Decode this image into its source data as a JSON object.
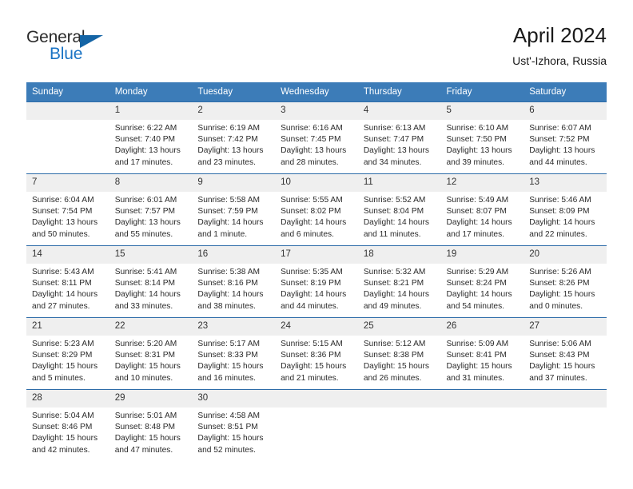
{
  "brand": {
    "word_one": "General",
    "word_two": "Blue",
    "accent_color": "#1a73c4",
    "triangle_color": "#1464a5"
  },
  "header": {
    "title": "April 2024",
    "subtitle": "Ust'-Izhora, Russia"
  },
  "calendar": {
    "header_bg": "#3c7cb8",
    "row_separator_color": "#2d6ca8",
    "daynum_bg": "#efefef",
    "weekday_headers": [
      "Sunday",
      "Monday",
      "Tuesday",
      "Wednesday",
      "Thursday",
      "Friday",
      "Saturday"
    ],
    "weeks": [
      [
        {
          "day": "",
          "sunrise": "",
          "sunset": "",
          "daylight_line1": "",
          "daylight_line2": ""
        },
        {
          "day": "1",
          "sunrise": "Sunrise: 6:22 AM",
          "sunset": "Sunset: 7:40 PM",
          "daylight_line1": "Daylight: 13 hours",
          "daylight_line2": "and 17 minutes."
        },
        {
          "day": "2",
          "sunrise": "Sunrise: 6:19 AM",
          "sunset": "Sunset: 7:42 PM",
          "daylight_line1": "Daylight: 13 hours",
          "daylight_line2": "and 23 minutes."
        },
        {
          "day": "3",
          "sunrise": "Sunrise: 6:16 AM",
          "sunset": "Sunset: 7:45 PM",
          "daylight_line1": "Daylight: 13 hours",
          "daylight_line2": "and 28 minutes."
        },
        {
          "day": "4",
          "sunrise": "Sunrise: 6:13 AM",
          "sunset": "Sunset: 7:47 PM",
          "daylight_line1": "Daylight: 13 hours",
          "daylight_line2": "and 34 minutes."
        },
        {
          "day": "5",
          "sunrise": "Sunrise: 6:10 AM",
          "sunset": "Sunset: 7:50 PM",
          "daylight_line1": "Daylight: 13 hours",
          "daylight_line2": "and 39 minutes."
        },
        {
          "day": "6",
          "sunrise": "Sunrise: 6:07 AM",
          "sunset": "Sunset: 7:52 PM",
          "daylight_line1": "Daylight: 13 hours",
          "daylight_line2": "and 44 minutes."
        }
      ],
      [
        {
          "day": "7",
          "sunrise": "Sunrise: 6:04 AM",
          "sunset": "Sunset: 7:54 PM",
          "daylight_line1": "Daylight: 13 hours",
          "daylight_line2": "and 50 minutes."
        },
        {
          "day": "8",
          "sunrise": "Sunrise: 6:01 AM",
          "sunset": "Sunset: 7:57 PM",
          "daylight_line1": "Daylight: 13 hours",
          "daylight_line2": "and 55 minutes."
        },
        {
          "day": "9",
          "sunrise": "Sunrise: 5:58 AM",
          "sunset": "Sunset: 7:59 PM",
          "daylight_line1": "Daylight: 14 hours",
          "daylight_line2": "and 1 minute."
        },
        {
          "day": "10",
          "sunrise": "Sunrise: 5:55 AM",
          "sunset": "Sunset: 8:02 PM",
          "daylight_line1": "Daylight: 14 hours",
          "daylight_line2": "and 6 minutes."
        },
        {
          "day": "11",
          "sunrise": "Sunrise: 5:52 AM",
          "sunset": "Sunset: 8:04 PM",
          "daylight_line1": "Daylight: 14 hours",
          "daylight_line2": "and 11 minutes."
        },
        {
          "day": "12",
          "sunrise": "Sunrise: 5:49 AM",
          "sunset": "Sunset: 8:07 PM",
          "daylight_line1": "Daylight: 14 hours",
          "daylight_line2": "and 17 minutes."
        },
        {
          "day": "13",
          "sunrise": "Sunrise: 5:46 AM",
          "sunset": "Sunset: 8:09 PM",
          "daylight_line1": "Daylight: 14 hours",
          "daylight_line2": "and 22 minutes."
        }
      ],
      [
        {
          "day": "14",
          "sunrise": "Sunrise: 5:43 AM",
          "sunset": "Sunset: 8:11 PM",
          "daylight_line1": "Daylight: 14 hours",
          "daylight_line2": "and 27 minutes."
        },
        {
          "day": "15",
          "sunrise": "Sunrise: 5:41 AM",
          "sunset": "Sunset: 8:14 PM",
          "daylight_line1": "Daylight: 14 hours",
          "daylight_line2": "and 33 minutes."
        },
        {
          "day": "16",
          "sunrise": "Sunrise: 5:38 AM",
          "sunset": "Sunset: 8:16 PM",
          "daylight_line1": "Daylight: 14 hours",
          "daylight_line2": "and 38 minutes."
        },
        {
          "day": "17",
          "sunrise": "Sunrise: 5:35 AM",
          "sunset": "Sunset: 8:19 PM",
          "daylight_line1": "Daylight: 14 hours",
          "daylight_line2": "and 44 minutes."
        },
        {
          "day": "18",
          "sunrise": "Sunrise: 5:32 AM",
          "sunset": "Sunset: 8:21 PM",
          "daylight_line1": "Daylight: 14 hours",
          "daylight_line2": "and 49 minutes."
        },
        {
          "day": "19",
          "sunrise": "Sunrise: 5:29 AM",
          "sunset": "Sunset: 8:24 PM",
          "daylight_line1": "Daylight: 14 hours",
          "daylight_line2": "and 54 minutes."
        },
        {
          "day": "20",
          "sunrise": "Sunrise: 5:26 AM",
          "sunset": "Sunset: 8:26 PM",
          "daylight_line1": "Daylight: 15 hours",
          "daylight_line2": "and 0 minutes."
        }
      ],
      [
        {
          "day": "21",
          "sunrise": "Sunrise: 5:23 AM",
          "sunset": "Sunset: 8:29 PM",
          "daylight_line1": "Daylight: 15 hours",
          "daylight_line2": "and 5 minutes."
        },
        {
          "day": "22",
          "sunrise": "Sunrise: 5:20 AM",
          "sunset": "Sunset: 8:31 PM",
          "daylight_line1": "Daylight: 15 hours",
          "daylight_line2": "and 10 minutes."
        },
        {
          "day": "23",
          "sunrise": "Sunrise: 5:17 AM",
          "sunset": "Sunset: 8:33 PM",
          "daylight_line1": "Daylight: 15 hours",
          "daylight_line2": "and 16 minutes."
        },
        {
          "day": "24",
          "sunrise": "Sunrise: 5:15 AM",
          "sunset": "Sunset: 8:36 PM",
          "daylight_line1": "Daylight: 15 hours",
          "daylight_line2": "and 21 minutes."
        },
        {
          "day": "25",
          "sunrise": "Sunrise: 5:12 AM",
          "sunset": "Sunset: 8:38 PM",
          "daylight_line1": "Daylight: 15 hours",
          "daylight_line2": "and 26 minutes."
        },
        {
          "day": "26",
          "sunrise": "Sunrise: 5:09 AM",
          "sunset": "Sunset: 8:41 PM",
          "daylight_line1": "Daylight: 15 hours",
          "daylight_line2": "and 31 minutes."
        },
        {
          "day": "27",
          "sunrise": "Sunrise: 5:06 AM",
          "sunset": "Sunset: 8:43 PM",
          "daylight_line1": "Daylight: 15 hours",
          "daylight_line2": "and 37 minutes."
        }
      ],
      [
        {
          "day": "28",
          "sunrise": "Sunrise: 5:04 AM",
          "sunset": "Sunset: 8:46 PM",
          "daylight_line1": "Daylight: 15 hours",
          "daylight_line2": "and 42 minutes."
        },
        {
          "day": "29",
          "sunrise": "Sunrise: 5:01 AM",
          "sunset": "Sunset: 8:48 PM",
          "daylight_line1": "Daylight: 15 hours",
          "daylight_line2": "and 47 minutes."
        },
        {
          "day": "30",
          "sunrise": "Sunrise: 4:58 AM",
          "sunset": "Sunset: 8:51 PM",
          "daylight_line1": "Daylight: 15 hours",
          "daylight_line2": "and 52 minutes."
        },
        {
          "day": "",
          "sunrise": "",
          "sunset": "",
          "daylight_line1": "",
          "daylight_line2": ""
        },
        {
          "day": "",
          "sunrise": "",
          "sunset": "",
          "daylight_line1": "",
          "daylight_line2": ""
        },
        {
          "day": "",
          "sunrise": "",
          "sunset": "",
          "daylight_line1": "",
          "daylight_line2": ""
        },
        {
          "day": "",
          "sunrise": "",
          "sunset": "",
          "daylight_line1": "",
          "daylight_line2": ""
        }
      ]
    ]
  }
}
